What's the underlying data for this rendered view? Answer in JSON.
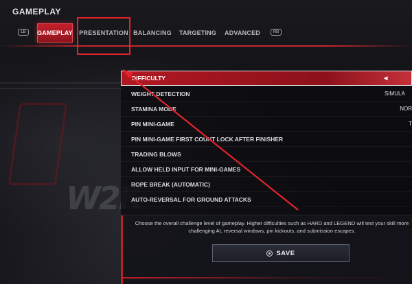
{
  "header": {
    "title": "GAMEPLAY"
  },
  "tabs": {
    "left_bumper": "LB",
    "right_bumper": "RB",
    "items": [
      {
        "label": "GAMEPLAY",
        "active": true
      },
      {
        "label": "PRESENTATION",
        "active": false
      },
      {
        "label": "BALANCING",
        "active": false
      },
      {
        "label": "TARGETING",
        "active": false
      },
      {
        "label": "ADVANCED",
        "active": false
      }
    ]
  },
  "settings": {
    "rows": [
      {
        "label": "DIFFICULTY",
        "value": "◀",
        "selected": true
      },
      {
        "label": "WEIGHT DETECTION",
        "value": "SIMULA"
      },
      {
        "label": "STAMINA MODE",
        "value": "NOR"
      },
      {
        "label": "PIN MINI-GAME",
        "value": "T"
      },
      {
        "label": "PIN MINI-GAME FIRST COUNT LOCK AFTER FINISHER",
        "value": ""
      },
      {
        "label": "TRADING BLOWS",
        "value": ""
      },
      {
        "label": "ALLOW HELD INPUT FOR MINI-GAMES",
        "value": ""
      },
      {
        "label": "ROPE BREAK (AUTOMATIC)",
        "value": ""
      },
      {
        "label": "AUTO-REVERSAL FOR GROUND ATTACKS",
        "value": ""
      }
    ]
  },
  "description": {
    "text": "Choose the overall challenge level of gameplay. Higher difficulties such as HARD and LEGEND will test your skill more challenging AI, reversal windows, pin kickouts, and submission escapes."
  },
  "save_button": {
    "label": "SAVE",
    "icon": "save-icon"
  },
  "background": {
    "logo_text": "W2K"
  },
  "colors": {
    "accent": "#c4202c",
    "annotation": "#e3232c"
  }
}
